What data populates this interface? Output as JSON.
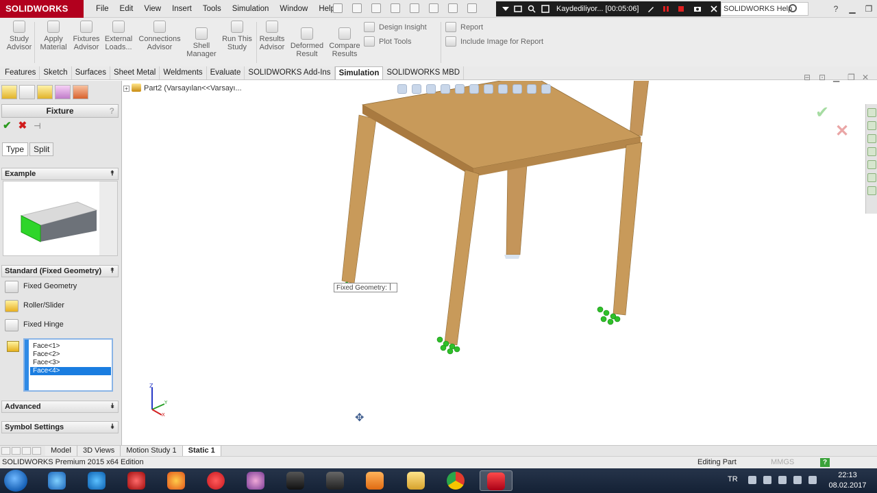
{
  "app": {
    "brand": "SOLIDWORKS",
    "menus": [
      "File",
      "Edit",
      "View",
      "Insert",
      "Tools",
      "Simulation",
      "Window",
      "Help"
    ],
    "recording_text": "Kaydediliyor... [00:05:06]",
    "help_search": "SOLIDWORKS Help"
  },
  "ribbon": {
    "study_advisor": [
      "Study",
      "Advisor"
    ],
    "apply_material": [
      "Apply",
      "Material"
    ],
    "fixtures_advisor": [
      "Fixtures",
      "Advisor"
    ],
    "external_loads": [
      "External",
      "Loads..."
    ],
    "connections_advisor": [
      "Connections",
      "Advisor"
    ],
    "shell_manager": [
      "Shell",
      "Manager"
    ],
    "run_this_study": [
      "Run This",
      "Study"
    ],
    "results_advisor": [
      "Results",
      "Advisor"
    ],
    "deformed_result": [
      "Deformed",
      "Result"
    ],
    "compare_results": [
      "Compare",
      "Results"
    ],
    "design_insight": "Design Insight",
    "plot_tools": "Plot Tools",
    "report": "Report",
    "include_image": "Include Image for Report"
  },
  "tabs": [
    "Features",
    "Sketch",
    "Surfaces",
    "Sheet Metal",
    "Weldments",
    "Evaluate",
    "SOLIDWORKS Add-Ins",
    "Simulation",
    "SOLIDWORKS MBD"
  ],
  "active_tab": "Simulation",
  "pm": {
    "title": "Fixture",
    "help": "?",
    "subtabs": [
      "Type",
      "Split"
    ],
    "example_label": "Example",
    "standard_label": "Standard (Fixed Geometry)",
    "options": [
      "Fixed Geometry",
      "Roller/Slider",
      "Fixed Hinge"
    ],
    "faces": [
      "Face<1>",
      "Face<2>",
      "Face<3>",
      "Face<4>"
    ],
    "selected_face": "Face<4>",
    "advanced_label": "Advanced",
    "symbol_settings_label": "Symbol Settings"
  },
  "tree": {
    "part": "Part2  (Varsayılan<<Varsayı..."
  },
  "callout": "Fixed Geometry:",
  "bottom_tabs": [
    "Model",
    "3D Views",
    "Motion Study 1",
    "Static 1"
  ],
  "active_bottom_tab": "Static 1",
  "status": {
    "left": "SOLIDWORKS Premium 2015 x64 Edition",
    "mode": "Editing Part",
    "units": "MMGS"
  },
  "taskbar": {
    "lang": "TR",
    "time": "22:13",
    "date": "08.02.2017"
  },
  "colors": {
    "brand": "#b2001e",
    "wood_top": "#c89a5a",
    "fixture": "#2fbf2a",
    "selection": "#1a7de0"
  }
}
